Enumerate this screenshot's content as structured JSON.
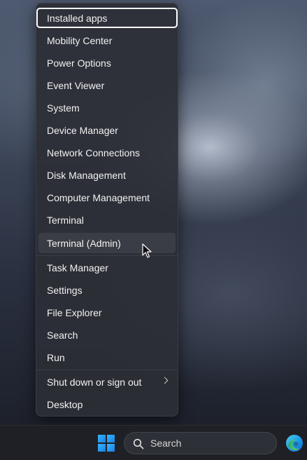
{
  "context_menu": {
    "items": [
      {
        "label": "Installed apps",
        "focused": true
      },
      {
        "label": "Mobility Center"
      },
      {
        "label": "Power Options"
      },
      {
        "label": "Event Viewer"
      },
      {
        "label": "System"
      },
      {
        "label": "Device Manager"
      },
      {
        "label": "Network Connections"
      },
      {
        "label": "Disk Management"
      },
      {
        "label": "Computer Management"
      },
      {
        "label": "Terminal"
      },
      {
        "label": "Terminal (Admin)",
        "hovered": true
      },
      {
        "label": "Task Manager"
      },
      {
        "label": "Settings"
      },
      {
        "label": "File Explorer"
      },
      {
        "label": "Search"
      },
      {
        "label": "Run"
      },
      {
        "label": "Shut down or sign out",
        "has_submenu": true
      },
      {
        "label": "Desktop"
      }
    ]
  },
  "taskbar": {
    "start_icon": "windows-logo-icon",
    "search": {
      "label": "Search",
      "icon": "search-icon"
    },
    "pinned_app_icon": "edge-browser-icon"
  },
  "colors": {
    "menu_background": "#2c2e36",
    "menu_text": "#f2f2f2",
    "focus_outline": "#ffffff",
    "taskbar_background": "#1f2026",
    "accent_blue": "#1b7fe0"
  }
}
